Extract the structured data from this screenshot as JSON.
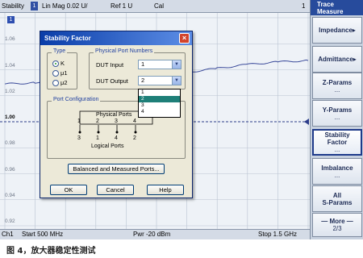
{
  "topbar": {
    "trace_label": "Stability",
    "trace_number": "1",
    "format": "Lin Mag  0.02 U/",
    "ref": "Ref 1 U",
    "cal": "Cal",
    "right_number": "1"
  },
  "plot": {
    "trace_tag": "1",
    "y_labels": [
      "1.06",
      "1.04",
      "1.02",
      "1.00",
      "0.98",
      "0.96",
      "0.94",
      "0.92"
    ],
    "reference_label": "1.00",
    "trace_color": "#3a4a9a"
  },
  "bottombar": {
    "channel": "Ch1",
    "start": "Start  500 MHz",
    "power": "Pwr  -20 dBm",
    "stop": "Stop  1.5 GHz"
  },
  "panel": {
    "title_line1": "Trace",
    "title_line2": "Measure",
    "keys": [
      {
        "label": "Impedance",
        "suffix": "▸"
      },
      {
        "label": "Admittance",
        "suffix": "▸"
      },
      {
        "label": "Z-Params",
        "sub": "..."
      },
      {
        "label": "Y-Params",
        "sub": "..."
      },
      {
        "label": "Stability\nFactor",
        "sub": "..."
      },
      {
        "label": "Imbalance",
        "sub": "..."
      },
      {
        "label": "All\nS-Params",
        "sub": ""
      },
      {
        "label": "— More —",
        "sub": "2/3"
      }
    ]
  },
  "dialog": {
    "title": "Stability Factor",
    "close": "×",
    "type_group": "Type",
    "type_options": [
      "K",
      "μ1",
      "μ2"
    ],
    "type_selected": "K",
    "ports_group": "Physical Port Numbers",
    "dut_input_label": "DUT Input",
    "dut_input_value": "1",
    "dut_output_label": "DUT Output",
    "dut_output_value": "2",
    "dropdown_options": [
      "1",
      "2",
      "3",
      "4"
    ],
    "dropdown_selected": "2",
    "port_config_group": "Port Configuration",
    "physical_ports_label": "Physical Ports",
    "physical_ports": [
      "1",
      "2",
      "3",
      "4"
    ],
    "logical_ports": [
      "3",
      "1",
      "4",
      "2"
    ],
    "logical_ports_label": "Logical Ports",
    "balanced_button": "Balanced and Measured Ports...",
    "ok_button": "OK",
    "cancel_button": "Cancel",
    "help_button": "Help"
  },
  "caption": "图 4，放大器稳定性测试",
  "chart_data": {
    "type": "line",
    "title": "",
    "xlabel": "",
    "ylabel": "",
    "xlim": [
      500,
      1500
    ],
    "ylim": [
      0.92,
      1.08
    ],
    "reference": 1.0,
    "series": [
      {
        "x": [
          500,
          600,
          700,
          800,
          900,
          1000,
          1100,
          1200,
          1300,
          1400,
          1500
        ],
        "values": [
          1.029,
          1.03,
          1.03,
          1.03,
          1.032,
          1.034,
          1.038,
          1.041,
          1.044,
          1.046,
          1.047
        ]
      }
    ]
  }
}
